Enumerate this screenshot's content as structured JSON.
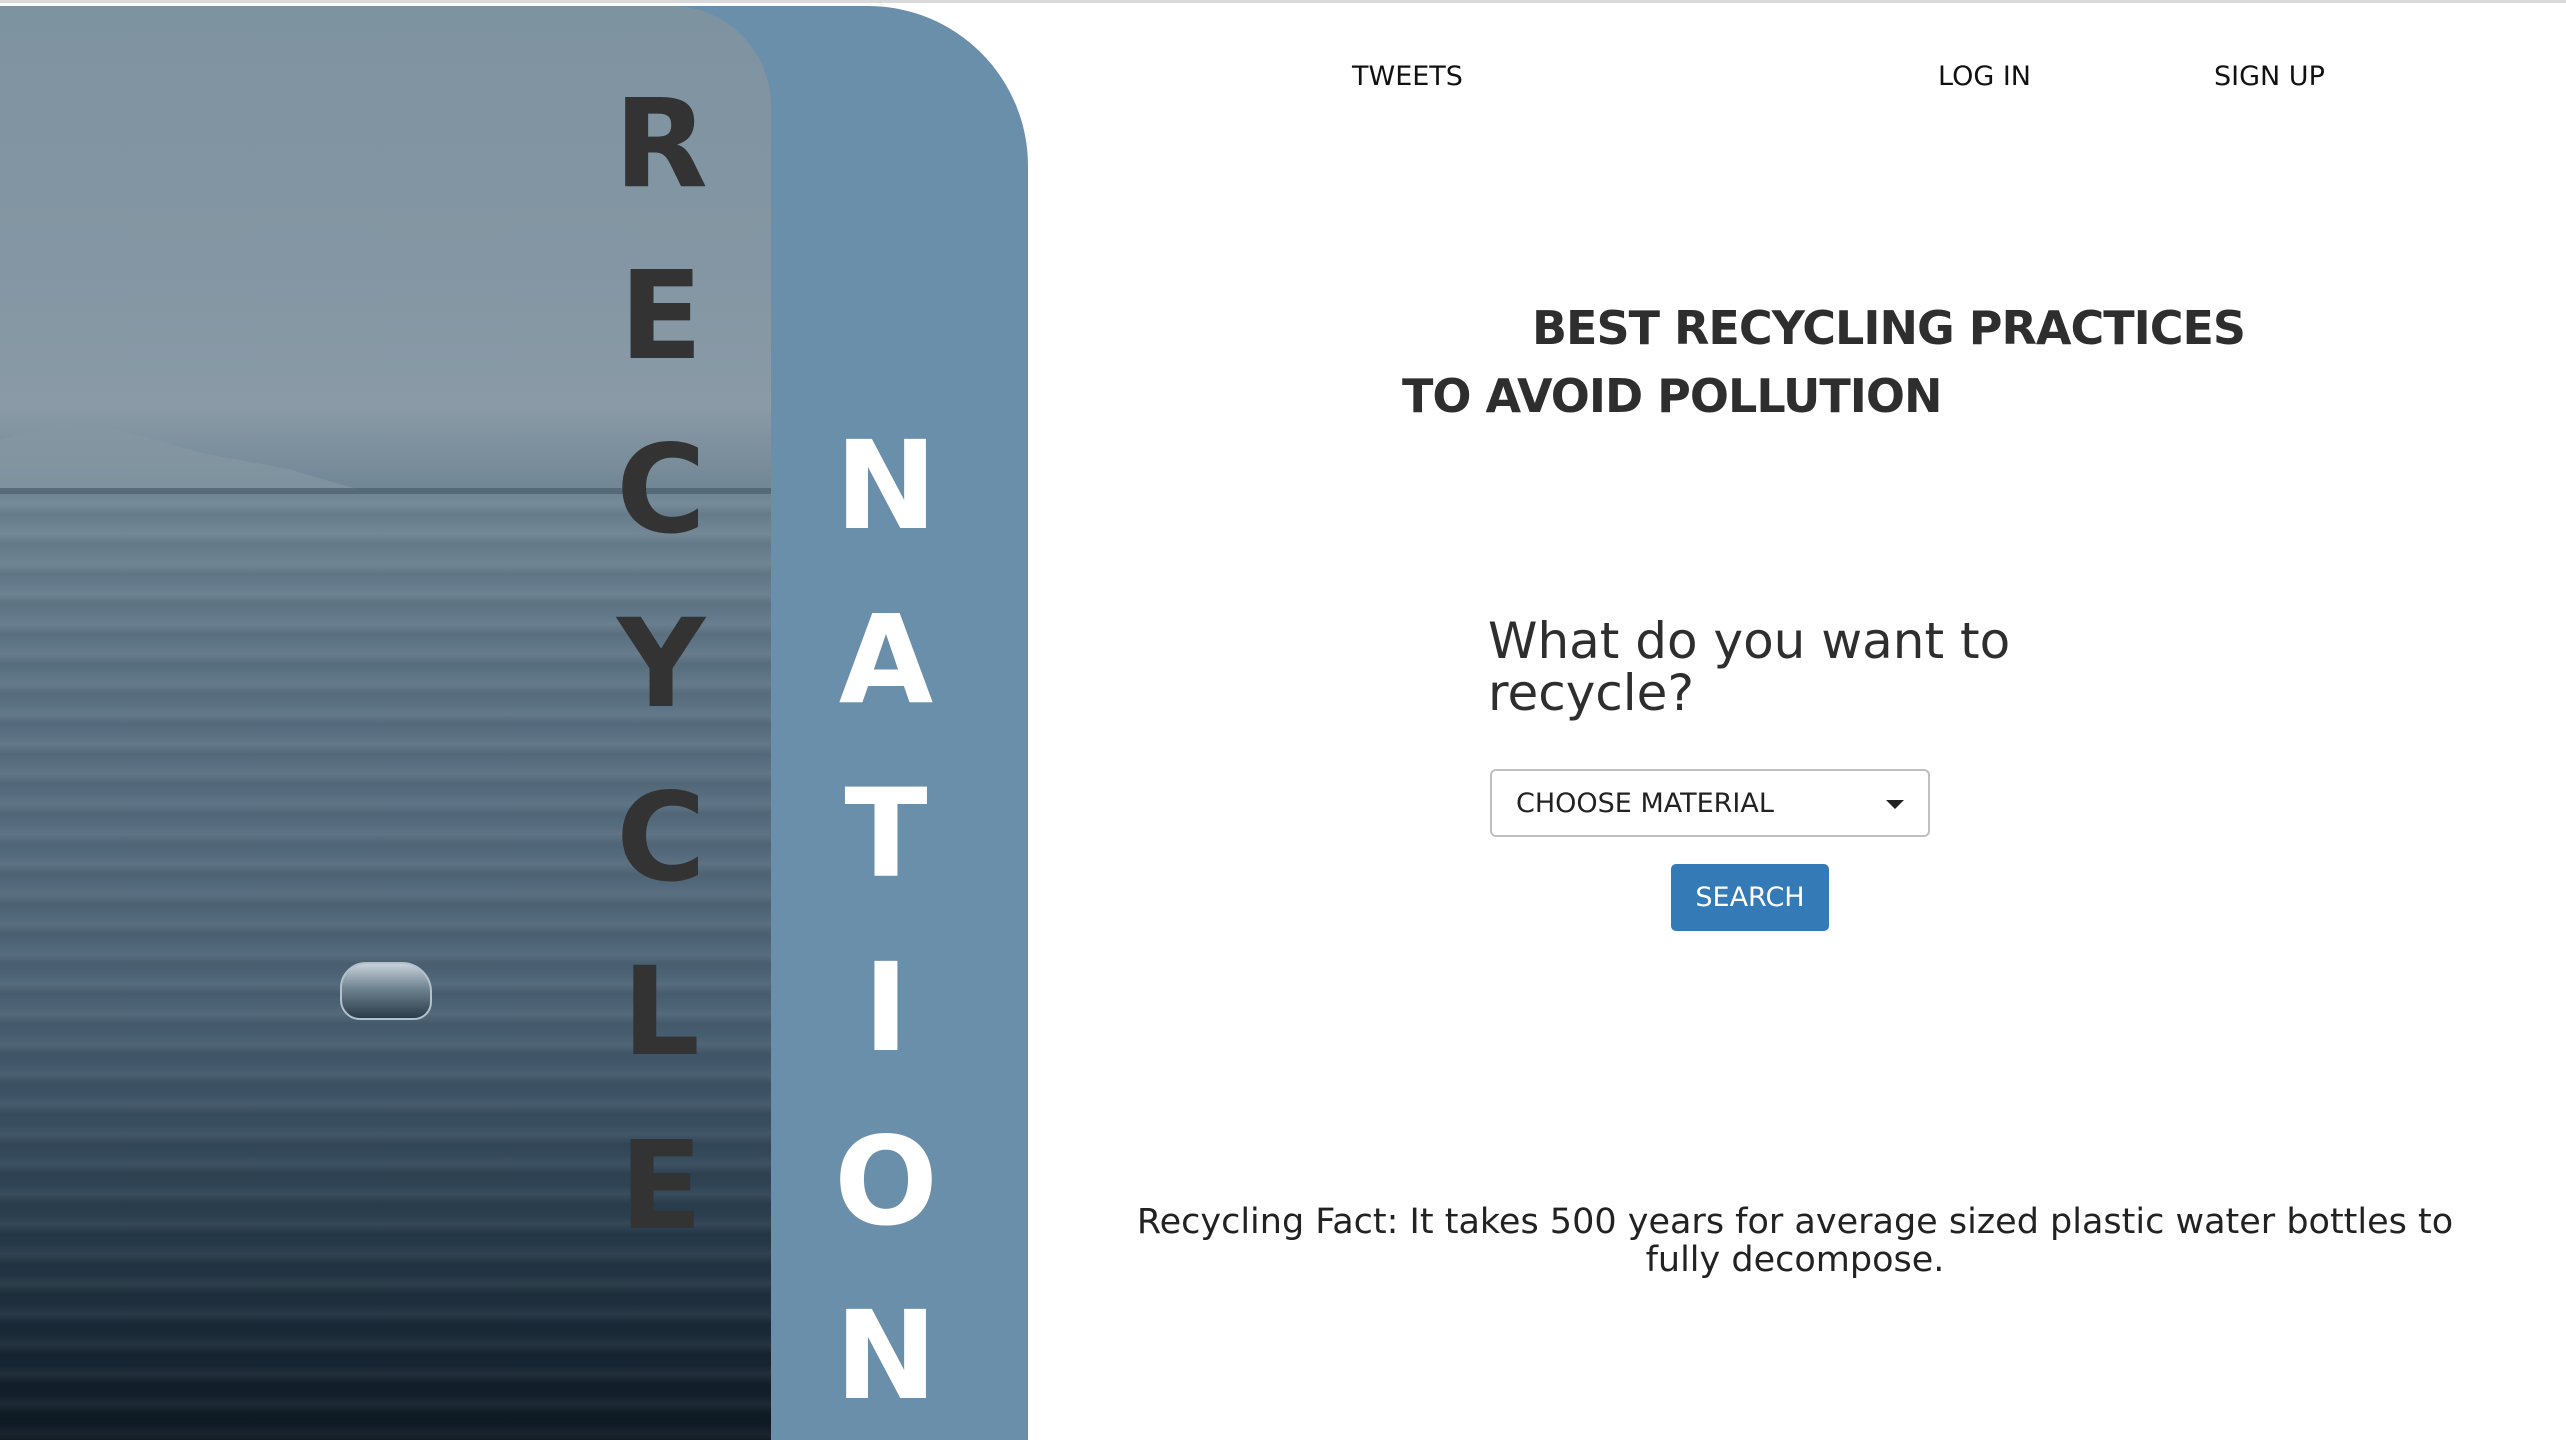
{
  "brand": {
    "word_left": [
      "R",
      "E",
      "C",
      "Y",
      "C",
      "L",
      "E"
    ],
    "word_right": [
      "N",
      "A",
      "T",
      "I",
      "O",
      "N"
    ]
  },
  "nav": {
    "tweets": "TWEETS",
    "login": "LOG IN",
    "signup": "SIGN UP"
  },
  "hero": {
    "headline_line1": "BEST RECYCLING PRACTICES",
    "headline_line2": "TO AVOID POLLUTION"
  },
  "search": {
    "question": "What do you want to recycle?",
    "select_value": "CHOOSE MATERIAL",
    "button_label": "SEARCH"
  },
  "fact": {
    "text": "Recycling Fact: It takes 500 years for average sized plastic water bottles to fully decompose."
  },
  "colors": {
    "accent_blue": "#6a8fab",
    "button_blue": "#337ab7",
    "title_dark": "#333333"
  }
}
